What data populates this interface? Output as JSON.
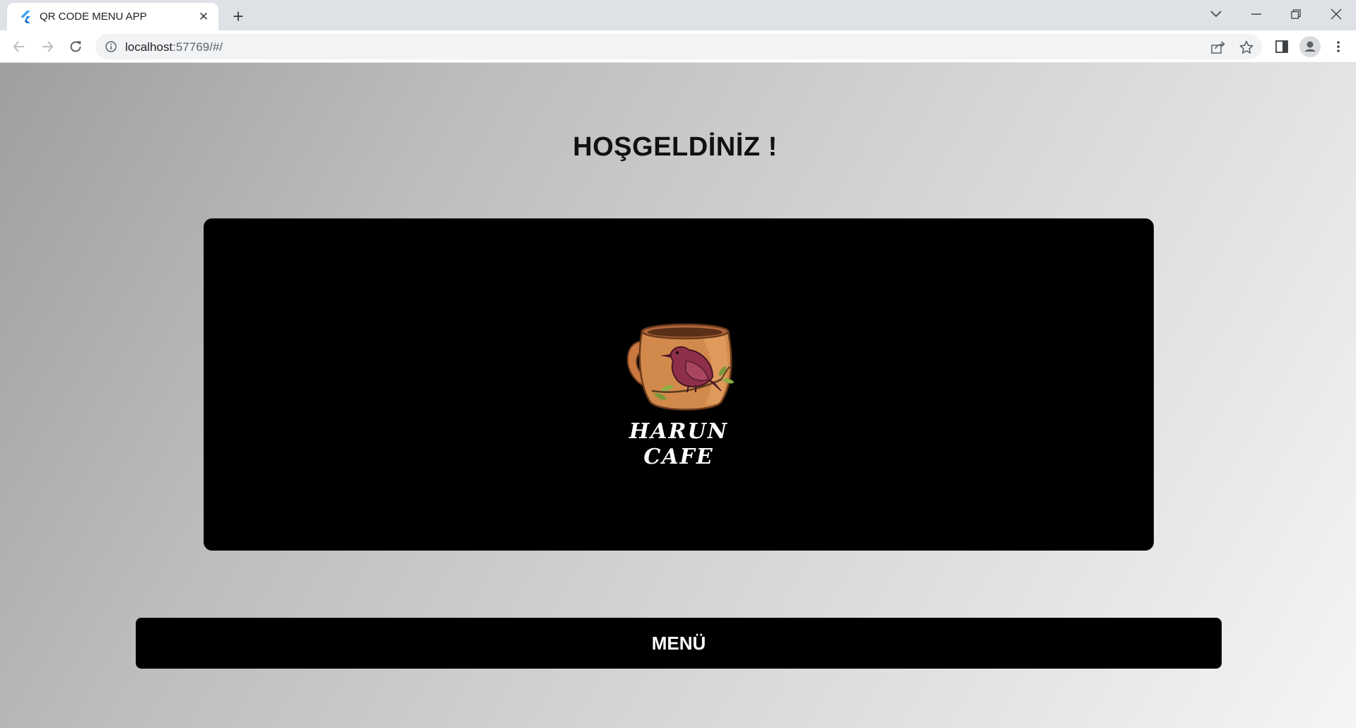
{
  "browser": {
    "tab": {
      "title": "QR CODE MENU APP",
      "favicon": "flutter-icon",
      "close": "✕"
    },
    "new_tab_label": "+",
    "address": {
      "host": "localhost",
      "path": ":57769/#/"
    },
    "colors": {
      "tabstrip": "#dee1e6",
      "toolbar": "#ffffff",
      "omnibox": "#f1f3f4",
      "flutter_blue": "#42a5f5"
    }
  },
  "page": {
    "welcome_title": "HOŞGELDİNİZ !",
    "logo": {
      "line1": "HARUN",
      "line2": "CAFE",
      "image": "coffee-mug-bird-logo"
    },
    "menu_button_label": "MENÜ",
    "colors": {
      "card": "#000000",
      "button": "#000000",
      "button_text": "#ffffff",
      "title": "#111111"
    }
  }
}
